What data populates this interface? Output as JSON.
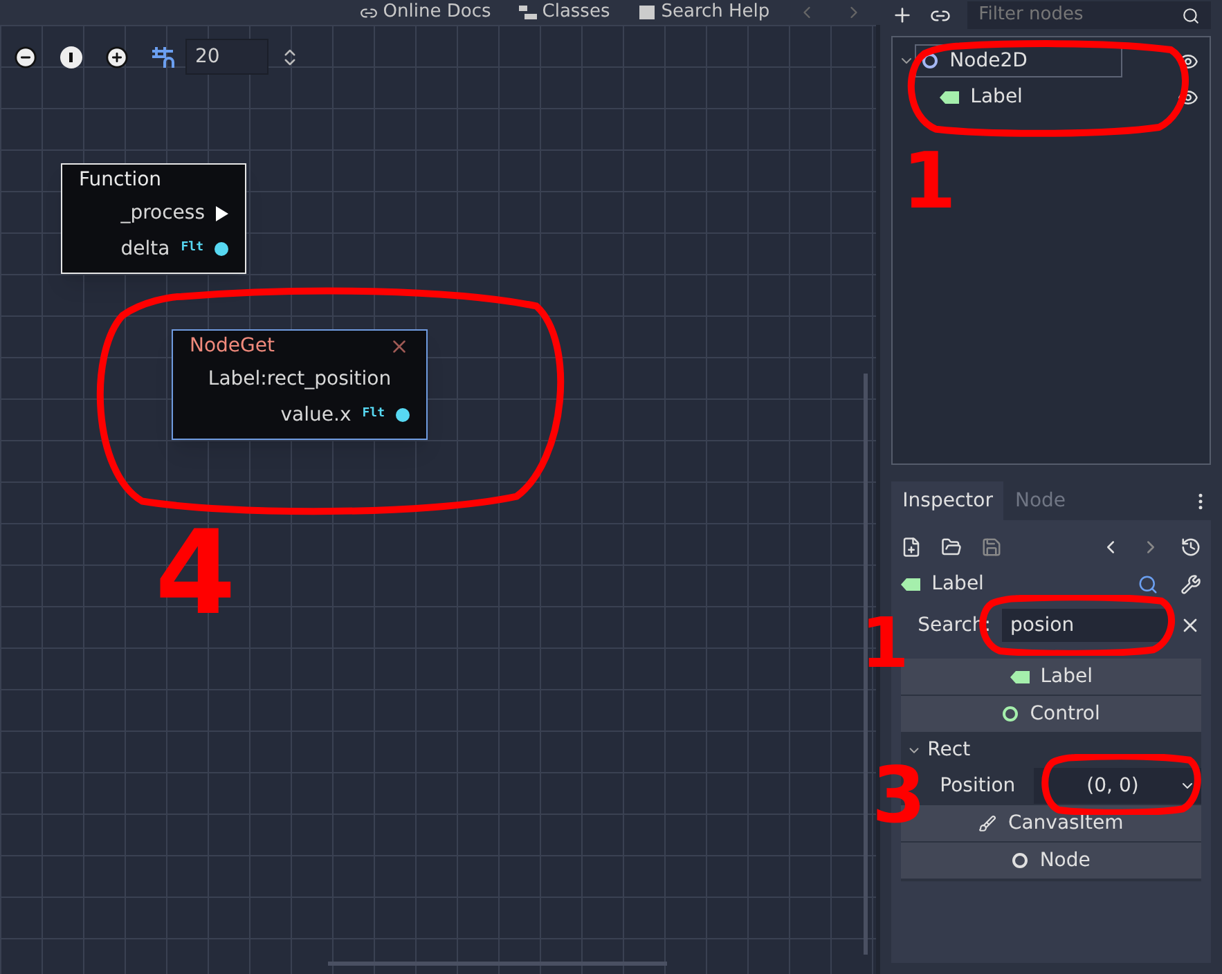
{
  "top_bar": {
    "links": [
      {
        "label": "Online Docs"
      },
      {
        "label": "Classes"
      },
      {
        "label": "Search Help"
      }
    ]
  },
  "graph_toolbar": {
    "snap_value": "20"
  },
  "graph_nodes": [
    {
      "kind": "function",
      "title": "Function",
      "rows": [
        {
          "kind": "sequence",
          "label": "_process"
        },
        {
          "kind": "data",
          "label": "delta",
          "type_tag": "Flt"
        }
      ]
    },
    {
      "kind": "node_get",
      "title": "NodeGet",
      "rows": [
        {
          "kind": "text",
          "label": "Label:rect_position"
        },
        {
          "kind": "data",
          "label": "value.x",
          "type_tag": "Flt"
        }
      ]
    }
  ],
  "scene_tree": {
    "filter_placeholder": "Filter nodes",
    "nodes": [
      {
        "kind": "node2d",
        "name": "Node2D",
        "expanded": true,
        "children": [
          {
            "kind": "label",
            "name": "Label"
          }
        ]
      }
    ]
  },
  "inspector": {
    "tabs": [
      {
        "label": "Inspector",
        "selected": true
      },
      {
        "label": "Node",
        "selected": false
      }
    ],
    "object": "Label",
    "search_label": "Search:",
    "search_value": "posion",
    "sections": [
      {
        "kind": "class_label",
        "label": "Label"
      },
      {
        "kind": "class_control",
        "label": "Control"
      },
      {
        "kind": "group",
        "label": "Rect",
        "expanded": true
      },
      {
        "kind": "property",
        "label": "Position",
        "value": "(0, 0)"
      },
      {
        "kind": "class_canvas_item",
        "label": "CanvasItem"
      },
      {
        "kind": "class_node",
        "label": "Node"
      }
    ]
  },
  "annotations": [
    {
      "label": "1"
    },
    {
      "label": "1"
    },
    {
      "label": "3"
    },
    {
      "label": "4"
    }
  ]
}
